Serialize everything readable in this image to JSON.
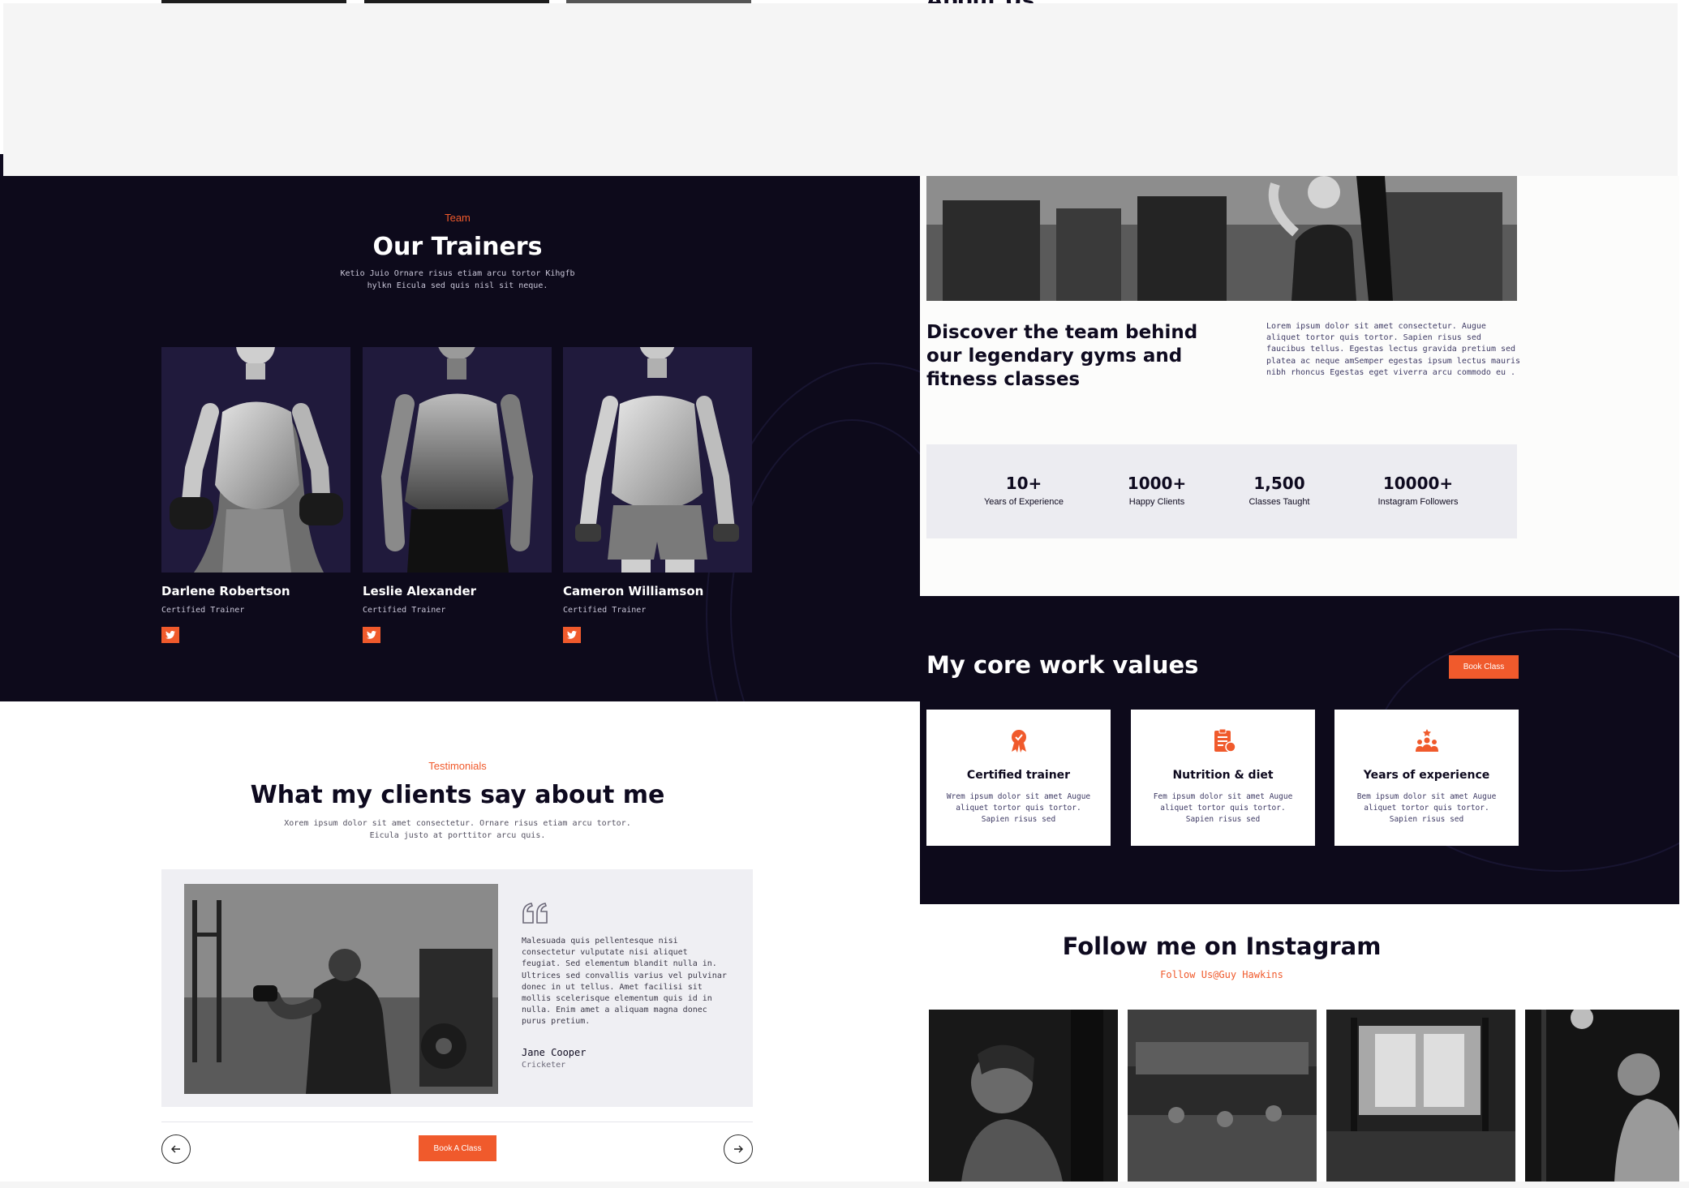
{
  "header": {
    "about_fragment": "About Us"
  },
  "team": {
    "eyebrow": "Team",
    "title": "Our Trainers",
    "description": "Ketio Juio Ornare risus etiam arcu tortor Kihgfb hylkn Eicula sed quis nisl sit neque.",
    "trainers": [
      {
        "name": "Darlene Robertson",
        "role": "Certified Trainer"
      },
      {
        "name": "Leslie Alexander",
        "role": "Certified Trainer"
      },
      {
        "name": "Cameron Williamson",
        "role": "Certified Trainer"
      }
    ],
    "social_icon": "twitter-icon"
  },
  "testimonials": {
    "eyebrow": "Testimonials",
    "title": "What my clients say about me",
    "description": "Xorem ipsum dolor sit amet consectetur. Ornare risus etiam arcu tortor. Eicula justo at porttitor arcu quis.",
    "quote": "Malesuada quis pellentesque nisi consectetur vulputate nisi aliquet feugiat. Sed elementum blandit nulla in. Ultrices sed convallis varius vel pulvinar donec in ut tellus. Amet facilisi sit mollis scelerisque elementum quis id in nulla. Enim amet a aliquam magna donec purus pretium.",
    "author_name": "Jane Cooper",
    "author_role": "Cricketer",
    "book_button": "Book A Class",
    "prev_icon": "arrow-left-icon",
    "next_icon": "arrow-right-icon"
  },
  "about": {
    "heading": "Discover the team behind our legendary gyms and fitness classes",
    "text": "Lorem ipsum dolor sit amet consectetur. Augue aliquet tortor quis tortor. Sapien risus sed faucibus tellus. Egestas lectus gravida pretium sed platea ac neque amSemper egestas ipsum lectus mauris nibh rhoncus Egestas eget viverra arcu commodo eu .",
    "stats": [
      {
        "value": "10+",
        "label": "Years of Experience"
      },
      {
        "value": "1000+",
        "label": "Happy Clients"
      },
      {
        "value": "1,500",
        "label": "Classes Taught"
      },
      {
        "value": "10000+",
        "label": "Instagram Followers"
      }
    ]
  },
  "values": {
    "title": "My core work values",
    "book_button": "Book Class",
    "cards": [
      {
        "icon": "award-badge-icon",
        "title": "Certified trainer",
        "text": "Wrem ipsum dolor sit amet  Augue aliquet tortor quis tortor. Sapien risus sed"
      },
      {
        "icon": "clipboard-diet-icon",
        "title": "Nutrition & diet",
        "text": "Fem ipsum dolor sit amet  Augue aliquet tortor quis tortor. Sapien risus sed"
      },
      {
        "icon": "team-people-icon",
        "title": "Years of experience",
        "text": "Bem ipsum dolor sit amet  Augue aliquet tortor quis tortor. Sapien risus sed"
      }
    ]
  },
  "instagram": {
    "title": "Follow me on Instagram",
    "subtitle": "Follow Us@Guy Hawkins"
  },
  "colors": {
    "accent": "#f05a2c",
    "dark": "#0d0a1b",
    "card_purple": "#201a3c"
  }
}
